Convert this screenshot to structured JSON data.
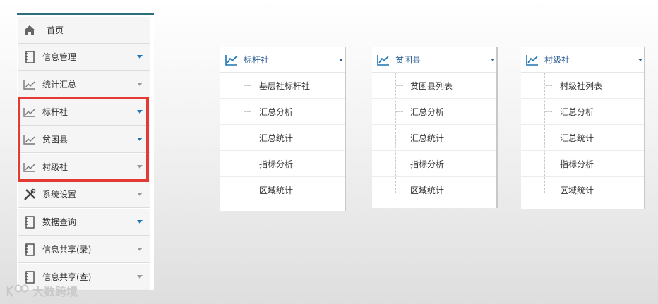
{
  "sidebar": {
    "items": [
      {
        "label": "首页",
        "icon": "home-icon",
        "caret": "none"
      },
      {
        "label": "信息管理",
        "icon": "notebook-icon",
        "caret": "blue"
      },
      {
        "label": "统计汇总",
        "icon": "line-chart-icon",
        "caret": "grey"
      },
      {
        "label": "标杆社",
        "icon": "line-chart-icon",
        "caret": "blue"
      },
      {
        "label": "贫困县",
        "icon": "line-chart-icon",
        "caret": "blue"
      },
      {
        "label": "村级社",
        "icon": "line-chart-icon",
        "caret": "grey"
      },
      {
        "label": "系统设置",
        "icon": "tools-icon",
        "caret": "grey"
      },
      {
        "label": "数据查询",
        "icon": "notebook-icon",
        "caret": "blue"
      },
      {
        "label": "信息共享(录)",
        "icon": "notebook-icon",
        "caret": "grey"
      },
      {
        "label": "信息共享(查)",
        "icon": "notebook-icon",
        "caret": "grey"
      }
    ]
  },
  "panels": [
    {
      "title": "标杆社",
      "items": [
        "基层社标杆社",
        "汇总分析",
        "汇总统计",
        "指标分析",
        "区域统计"
      ]
    },
    {
      "title": "贫困县",
      "items": [
        "贫困县列表",
        "汇总分析",
        "汇总统计",
        "指标分析",
        "区域统计"
      ]
    },
    {
      "title": "村级社",
      "items": [
        "村级社列表",
        "汇总分析",
        "汇总统计",
        "指标分析",
        "区域统计"
      ]
    }
  ],
  "watermark": {
    "text": "大数跨境"
  },
  "colors": {
    "accent": "#1e75b6",
    "highlight": "#e53935",
    "panel_title": "#2b5d94"
  }
}
